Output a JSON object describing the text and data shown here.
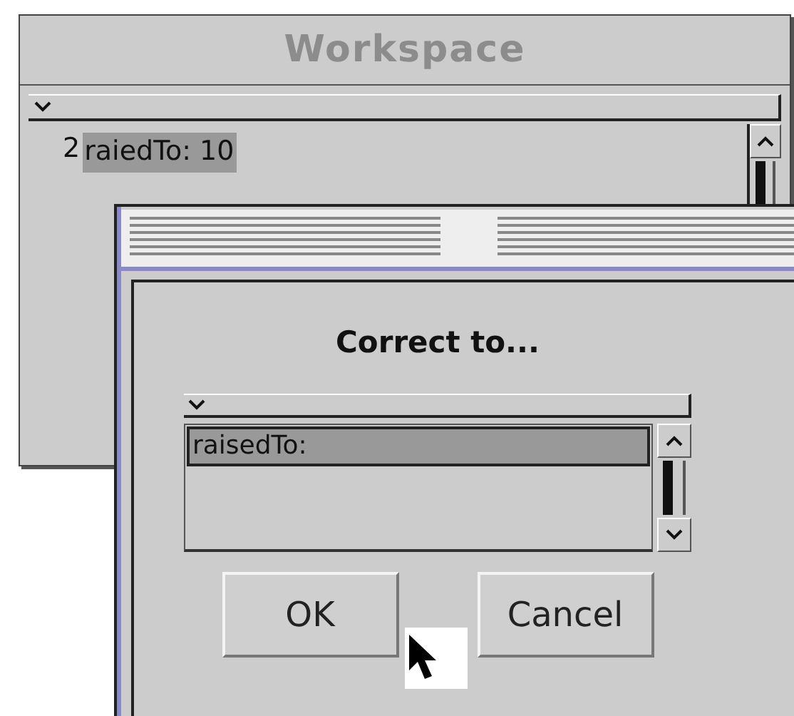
{
  "workspace": {
    "title": "Workspace",
    "text_prefix": "2",
    "selected_text": "raiedTo: 10"
  },
  "dialog": {
    "prompt": "Correct to...",
    "items": [
      {
        "label": "raisedTo:",
        "selected": true
      }
    ],
    "buttons": [
      "OK",
      "Cancel"
    ]
  }
}
